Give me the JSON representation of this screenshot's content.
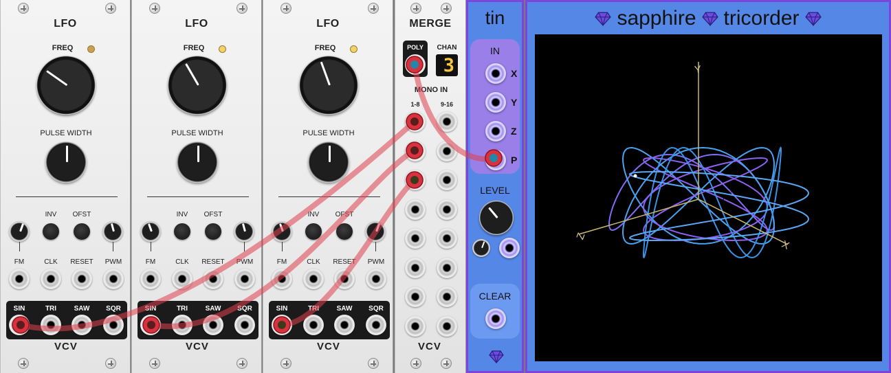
{
  "lfo_modules": [
    {
      "title": "LFO",
      "freq_label": "FREQ",
      "pulse_width_label": "PULSE WIDTH",
      "inv_label": "INV",
      "ofst_label": "OFST",
      "inputs": [
        "FM",
        "CLK",
        "RESET",
        "PWM"
      ],
      "outputs": [
        "SIN",
        "TRI",
        "SAW",
        "SQR"
      ],
      "brand": "VCV"
    },
    {
      "title": "LFO",
      "freq_label": "FREQ",
      "pulse_width_label": "PULSE WIDTH",
      "inv_label": "INV",
      "ofst_label": "OFST",
      "inputs": [
        "FM",
        "CLK",
        "RESET",
        "PWM"
      ],
      "outputs": [
        "SIN",
        "TRI",
        "SAW",
        "SQR"
      ],
      "brand": "VCV"
    },
    {
      "title": "LFO",
      "freq_label": "FREQ",
      "pulse_width_label": "PULSE WIDTH",
      "inv_label": "INV",
      "ofst_label": "OFST",
      "inputs": [
        "FM",
        "CLK",
        "RESET",
        "PWM"
      ],
      "outputs": [
        "SIN",
        "TRI",
        "SAW",
        "SQR"
      ],
      "brand": "VCV"
    }
  ],
  "merge": {
    "title": "MERGE",
    "poly_label": "POLY",
    "chan_label": "CHAN",
    "chan_value": "3",
    "mono_in_label": "MONO IN",
    "col1_label": "1-8",
    "col2_label": "9-16",
    "brand": "VCV"
  },
  "tin": {
    "title": "tin",
    "in_label": "IN",
    "port_x": "X",
    "port_y": "Y",
    "port_z": "Z",
    "port_p": "P",
    "level_label": "LEVEL",
    "clear_label": "CLEAR",
    "logo_icon": "sapphire-gem-icon"
  },
  "tricorder": {
    "title_left": "sapphire",
    "title_right": "tricorder",
    "axis_x": "X",
    "axis_y": "Y",
    "axis_z": "Z",
    "logo_icon": "sapphire-gem-icon"
  },
  "colors": {
    "panel": "#eeeeee",
    "tin_bg": "#5588e6",
    "tin_border": "#7b46d9",
    "cable": "#e0404e",
    "led_dim": "#c8a056",
    "led_lit": "#f2d36a",
    "screen_bg": "#000000"
  }
}
